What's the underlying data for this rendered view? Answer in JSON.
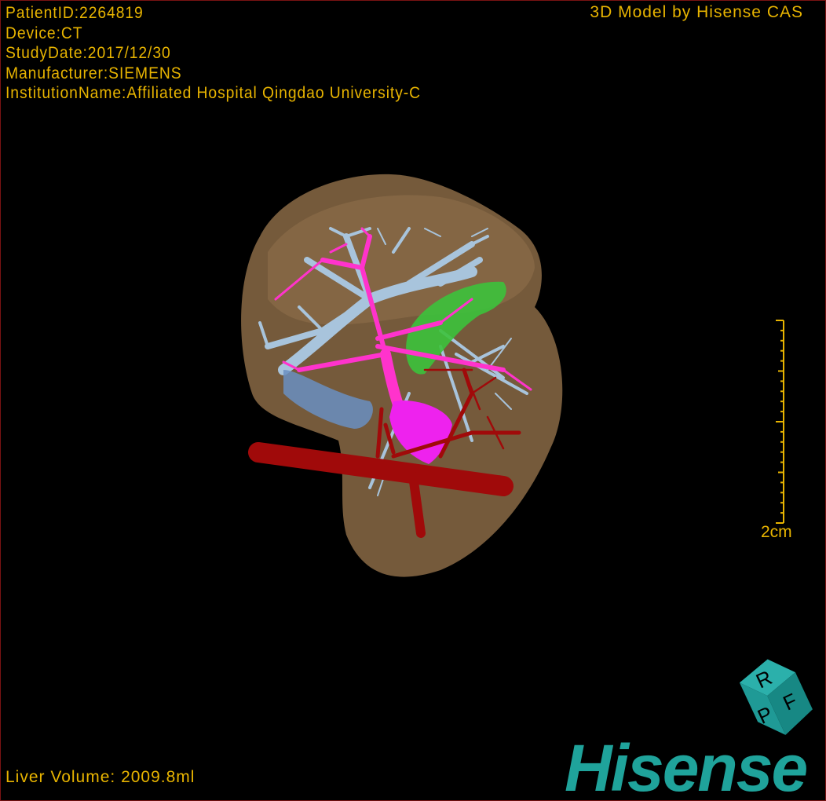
{
  "info": {
    "patient_id": "PatientID:2264819",
    "device": "Device:CT",
    "study_date": "StudyDate:2017/12/30",
    "manufacturer": "Manufacturer:SIEMENS",
    "institution": "InstitutionName:Affiliated Hospital Qingdao University-C"
  },
  "brand_caption": "3D Model by Hisense CAS",
  "liver_volume": "Liver Volume: 2009.8ml",
  "scale_bar": {
    "label": "2cm"
  },
  "orientation_cube": {
    "faces": [
      "P",
      "R",
      "F"
    ],
    "color": "#1f9a96"
  },
  "logo": "Hisense",
  "colors": {
    "text": "#e8b400",
    "border": "#7a1212",
    "liver": "#8a6a45",
    "portal_vein": "#ff33cc",
    "hepatic_vein": "#a8c4dc",
    "artery": "#a00a0a",
    "gallbladder": "#3cc23c",
    "logo": "#1fa39b"
  }
}
